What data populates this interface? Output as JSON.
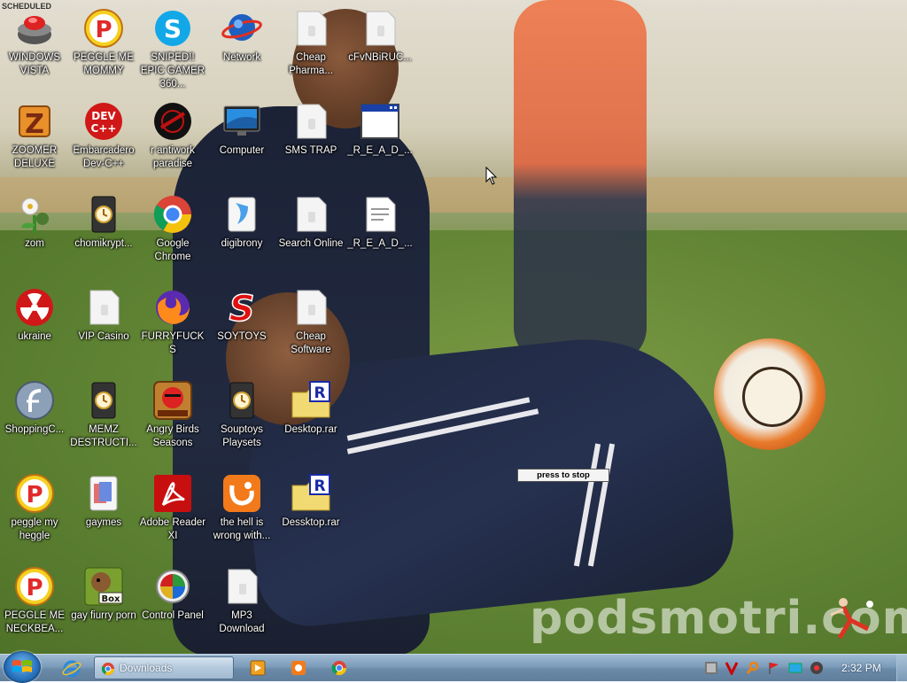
{
  "wallpaper": {
    "watermark": "podsmotri.com",
    "top_left_text": "SCHEDULED"
  },
  "desktop_icons": [
    {
      "label": "WINDOWS VISTA",
      "icon": "vista-bowl-icon"
    },
    {
      "label": "PEGGLE ME MOMMY",
      "icon": "peggle-icon"
    },
    {
      "label": "SNIPED!! EPIC GAMER 360...",
      "icon": "skype-icon"
    },
    {
      "label": "Network",
      "icon": "network-globe-icon"
    },
    {
      "label": "Cheap Pharma...",
      "icon": "blank-file-icon"
    },
    {
      "label": "cFvNBiRUC...",
      "icon": "blank-file-icon"
    },
    {
      "label": "ZOOMER DELUXE",
      "icon": "zoomer-z-icon"
    },
    {
      "label": "Embarcadero Dev-C++",
      "icon": "dev-cpp-icon"
    },
    {
      "label": "r antiwork paradise",
      "icon": "antiwork-icon"
    },
    {
      "label": "Computer",
      "icon": "computer-monitor-icon"
    },
    {
      "label": "SMS TRAP",
      "icon": "blank-file-icon"
    },
    {
      "label": "_R_E_A_D_...",
      "icon": "window-app-icon"
    },
    {
      "label": "zom",
      "icon": "zombie-plant-icon"
    },
    {
      "label": "chomikrypt...",
      "icon": "hourglass-file-icon"
    },
    {
      "label": "Google Chrome",
      "icon": "chrome-icon"
    },
    {
      "label": "digibrony",
      "icon": "digibrony-icon"
    },
    {
      "label": "Search Online",
      "icon": "blank-file-icon"
    },
    {
      "label": "_R_E_A_D_...",
      "icon": "text-file-icon"
    },
    {
      "label": "ukraine",
      "icon": "radiation-icon"
    },
    {
      "label": "VIP Casino",
      "icon": "blank-file-icon"
    },
    {
      "label": "FURRYFUCKS",
      "icon": "firefox-icon"
    },
    {
      "label": "SOYTOYS",
      "icon": "soytoys-s-icon"
    },
    {
      "label": "Cheap Software",
      "icon": "blank-file-icon"
    },
    {
      "label": "ShoppingC...",
      "icon": "flash-icon"
    },
    {
      "label": "MEMZ DESTRUCTI...",
      "icon": "hourglass-file-icon"
    },
    {
      "label": "Angry Birds Seasons",
      "icon": "angry-birds-icon"
    },
    {
      "label": "Souptoys Playsets",
      "icon": "hourglass-file-icon"
    },
    {
      "label": "Desktop.rar",
      "icon": "rar-archive-icon"
    },
    {
      "label": "peggle my heggle",
      "icon": "peggle-icon"
    },
    {
      "label": "gaymes",
      "icon": "media-file-icon"
    },
    {
      "label": "Adobe Reader XI",
      "icon": "adobe-reader-icon"
    },
    {
      "label": "the hell is wrong with...",
      "icon": "uc-browser-icon"
    },
    {
      "label": "Dessktop.rar",
      "icon": "rar-archive-icon"
    },
    {
      "label": "PEGGLE ME NECKBEA...",
      "icon": "peggle-icon"
    },
    {
      "label": "gay fiurry porn",
      "icon": "beaver-box-icon"
    },
    {
      "label": "Control Panel",
      "icon": "control-panel-icon"
    },
    {
      "label": "MP3 Download",
      "icon": "blank-file-icon"
    }
  ],
  "overlay": {
    "press_to_stop": "press to stop"
  },
  "taskbar": {
    "task_label": "Downloads",
    "clock": "2:32 PM"
  }
}
